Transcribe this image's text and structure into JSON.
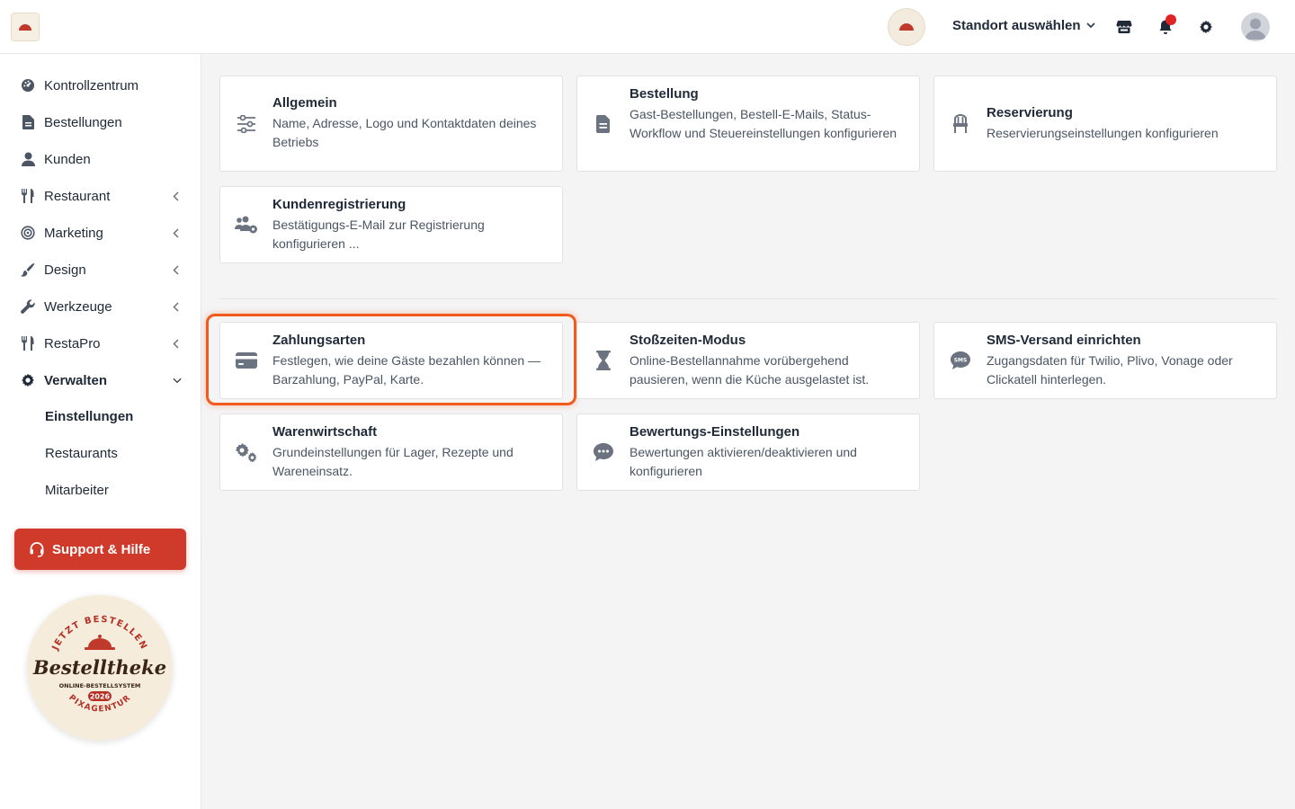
{
  "header": {
    "location_select_label": "Standort auswählen",
    "icons": [
      "store-icon",
      "bell-icon",
      "gear-icon",
      "user-avatar-icon"
    ]
  },
  "sidebar": {
    "items": [
      {
        "label": "Kontrollzentrum",
        "icon": "dashboard-icon",
        "has_submenu": false
      },
      {
        "label": "Bestellungen",
        "icon": "document-icon",
        "has_submenu": false
      },
      {
        "label": "Kunden",
        "icon": "user-icon",
        "has_submenu": false
      },
      {
        "label": "Restaurant",
        "icon": "cutlery-icon",
        "has_submenu": true
      },
      {
        "label": "Marketing",
        "icon": "target-icon",
        "has_submenu": true
      },
      {
        "label": "Design",
        "icon": "brush-icon",
        "has_submenu": true
      },
      {
        "label": "Werkzeuge",
        "icon": "wrench-icon",
        "has_submenu": true
      },
      {
        "label": "RestaPro",
        "icon": "cutlery-icon",
        "has_submenu": true
      },
      {
        "label": "Verwalten",
        "icon": "gear-icon",
        "has_submenu": true,
        "expanded": true
      }
    ],
    "subitems": [
      {
        "label": "Einstellungen",
        "active": true
      },
      {
        "label": "Restaurants",
        "active": false
      },
      {
        "label": "Mitarbeiter",
        "active": false
      }
    ],
    "support_label": "Support & Hilfe"
  },
  "badge": {
    "arc_top": "JETZT BESTELLEN",
    "brand": "Bestelltheke",
    "tagline": "ONLINE-BESTELLSYSTEM",
    "year": "2026",
    "arc_bottom": "PIXAGENTUR"
  },
  "cards": [
    {
      "title": "Allgemein",
      "description": "Name, Adresse, Logo und Kontaktdaten deines Betriebs",
      "icon": "sliders-icon"
    },
    {
      "title": "Bestellung",
      "description": "Gast-Bestellungen, Bestell-E-Mails, Status-Workflow und Steuereinstellungen konfigurieren",
      "icon": "document-icon"
    },
    {
      "title": "Reservierung",
      "description": "Reservierungseinstellungen konfigurieren",
      "icon": "chair-icon"
    },
    {
      "title": "Kundenregistrierung",
      "description": "Bestätigungs-E-Mail zur Registrierung konfigurieren ...",
      "icon": "users-gear-icon"
    },
    {
      "title": "Zahlungsarten",
      "description": "Festlegen, wie deine Gäste bezahlen können — Barzahlung, PayPal, Karte.",
      "icon": "credit-card-icon",
      "highlighted": true
    },
    {
      "title": "Stoßzeiten-Modus",
      "description": "Online-Bestellannahme vorübergehend pausieren, wenn die Küche ausgelastet ist.",
      "icon": "hourglass-icon"
    },
    {
      "title": "SMS-Versand einrichten",
      "description": "Zugangsdaten für Twilio, Plivo, Vonage oder Clickatell hinterlegen.",
      "icon": "sms-icon"
    },
    {
      "title": "Warenwirtschaft",
      "description": "Grundeinstellungen für Lager, Rezepte und Wareneinsatz.",
      "icon": "gears-icon"
    },
    {
      "title": "Bewertungs-Einstellungen",
      "description": "Bewertungen aktivieren/deaktivieren und konfigurieren",
      "icon": "comment-icon"
    }
  ],
  "colors": {
    "accent": "#d03a2b",
    "highlight": "#f05a1a",
    "icon_gray": "#6b7280"
  }
}
